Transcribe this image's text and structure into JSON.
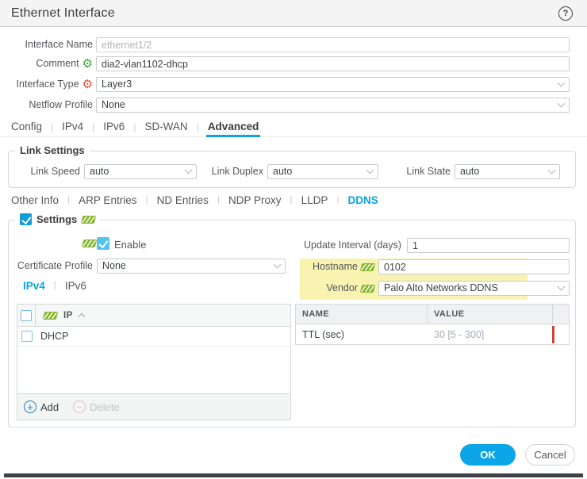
{
  "dialog": {
    "title": "Ethernet Interface",
    "help": "?"
  },
  "form": {
    "interface_name": {
      "label": "Interface Name",
      "value": "ethernet1/2"
    },
    "comment": {
      "label": "Comment",
      "value": "dia2-vlan1102-dhcp"
    },
    "interface_type": {
      "label": "Interface Type",
      "value": "Layer3"
    },
    "netflow_profile": {
      "label": "Netflow Profile",
      "value": "None"
    }
  },
  "tabs": {
    "items": [
      "Config",
      "IPv4",
      "IPv6",
      "SD-WAN",
      "Advanced"
    ],
    "active": "Advanced"
  },
  "link_settings": {
    "legend": "Link Settings",
    "link_speed": {
      "label": "Link Speed",
      "value": "auto"
    },
    "link_duplex": {
      "label": "Link Duplex",
      "value": "auto"
    },
    "link_state": {
      "label": "Link State",
      "value": "auto"
    }
  },
  "subtabs": {
    "items": [
      "Other Info",
      "ARP Entries",
      "ND Entries",
      "NDP Proxy",
      "LLDP",
      "DDNS"
    ],
    "active": "DDNS"
  },
  "ddns": {
    "legend": "Settings",
    "enable_label": "Enable",
    "certificate_profile": {
      "label": "Certificate Profile",
      "value": "None"
    },
    "ip_tabs": {
      "items": [
        "IPv4",
        "IPv6"
      ],
      "active": "IPv4"
    },
    "update_interval": {
      "label": "Update Interval (days)",
      "value": "1"
    },
    "hostname": {
      "label": "Hostname",
      "value": "0102"
    },
    "vendor": {
      "label": "Vendor",
      "value": "Palo Alto Networks DDNS"
    },
    "ip_table": {
      "column_ip": "IP",
      "rows": [
        "DHCP"
      ],
      "add_label": "Add",
      "delete_label": "Delete"
    },
    "vendor_table": {
      "col_name": "NAME",
      "col_value": "VALUE",
      "rows": [
        {
          "name": "TTL (sec)",
          "value": "30 [5 - 300]"
        }
      ]
    }
  },
  "footer": {
    "ok_label": "OK",
    "cancel_label": "Cancel"
  },
  "colors": {
    "accent_blue": "#0ca4e0",
    "highlight_yellow": "#f9f3b1",
    "override_green": "#86b52b",
    "error_red": "#cf4437",
    "ok_button": "#0ca6e8"
  }
}
